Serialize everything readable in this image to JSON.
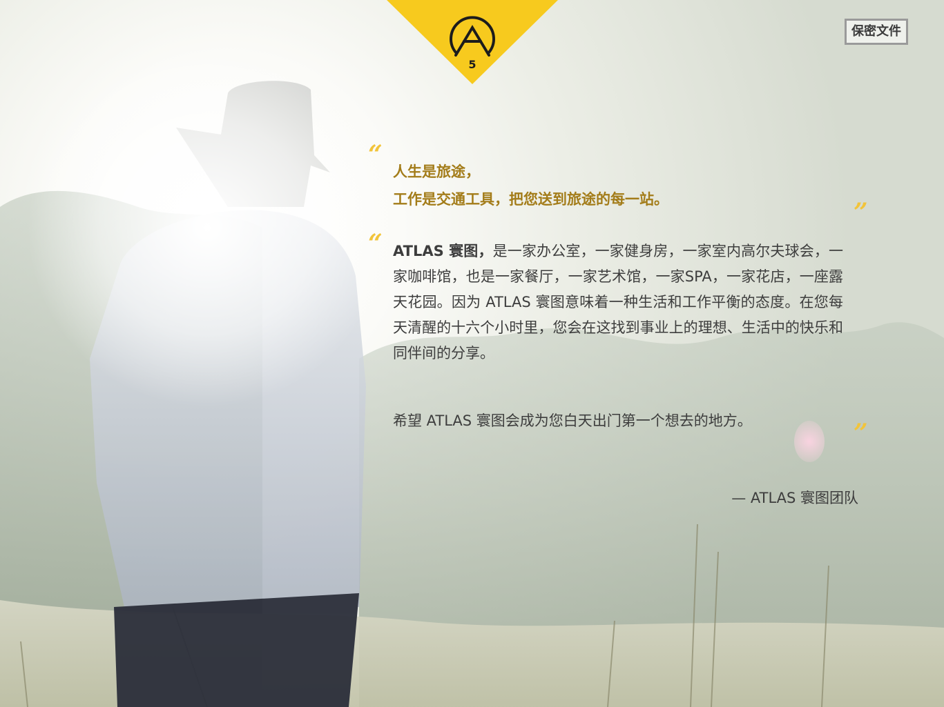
{
  "page_number": "5",
  "confidential_label": "保密文件",
  "quote": {
    "open_mark": "“",
    "close_mark": "”",
    "line1": "人生是旅途，",
    "line2": "工作是交通工具，把您送到旅途的每一站。"
  },
  "intro": {
    "open_mark": "“",
    "close_mark": "”",
    "brand": "ATLAS 寰图，",
    "body": "是一家办公室，一家健身房，一家室内高尔夫球会，一家咖啡馆，也是一家餐厅，一家艺术馆，一家SPA，一家花店，一座露天花园。因为 ATLAS 寰图意味着一种生活和工作平衡的态度。在您每天清醒的十六个小时里，您会在这找到事业上的理想、生活中的快乐和同伴间的分享。",
    "wish": "希望 ATLAS 寰图会成为您白天出门第一个想去的地方。"
  },
  "signature": "— ATLAS 寰图团队",
  "colors": {
    "accent_yellow": "#f7ca1e",
    "quote_gold": "#a37c19",
    "body_text": "#3d3d3d"
  }
}
